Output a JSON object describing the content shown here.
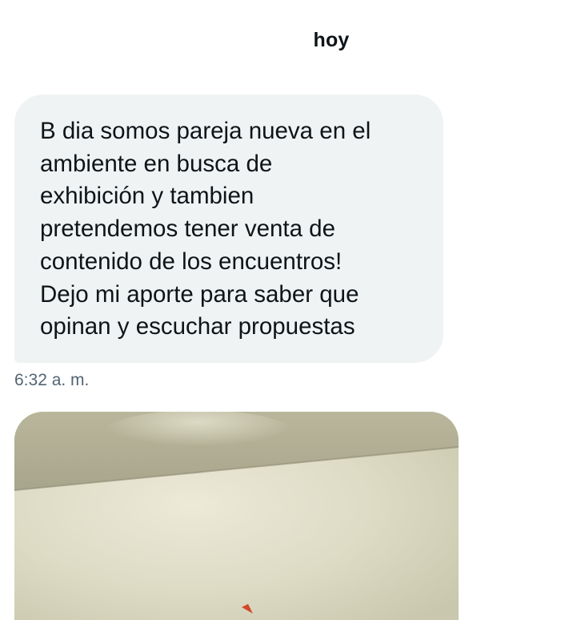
{
  "date_divider": "hoy",
  "message": {
    "lines": [
      "B dia somos pareja nueva en el",
      "ambiente en busca de",
      "exhibición y tambien",
      "pretendemos tener venta de",
      "contenido de los encuentros!",
      "Dejo mi aporte para saber que",
      "opinan y escuchar propuestas"
    ],
    "time": "6:32 a. m."
  },
  "colors": {
    "bubble_bg": "#eff3f4",
    "text": "#0f1419",
    "muted_text": "#536471"
  }
}
